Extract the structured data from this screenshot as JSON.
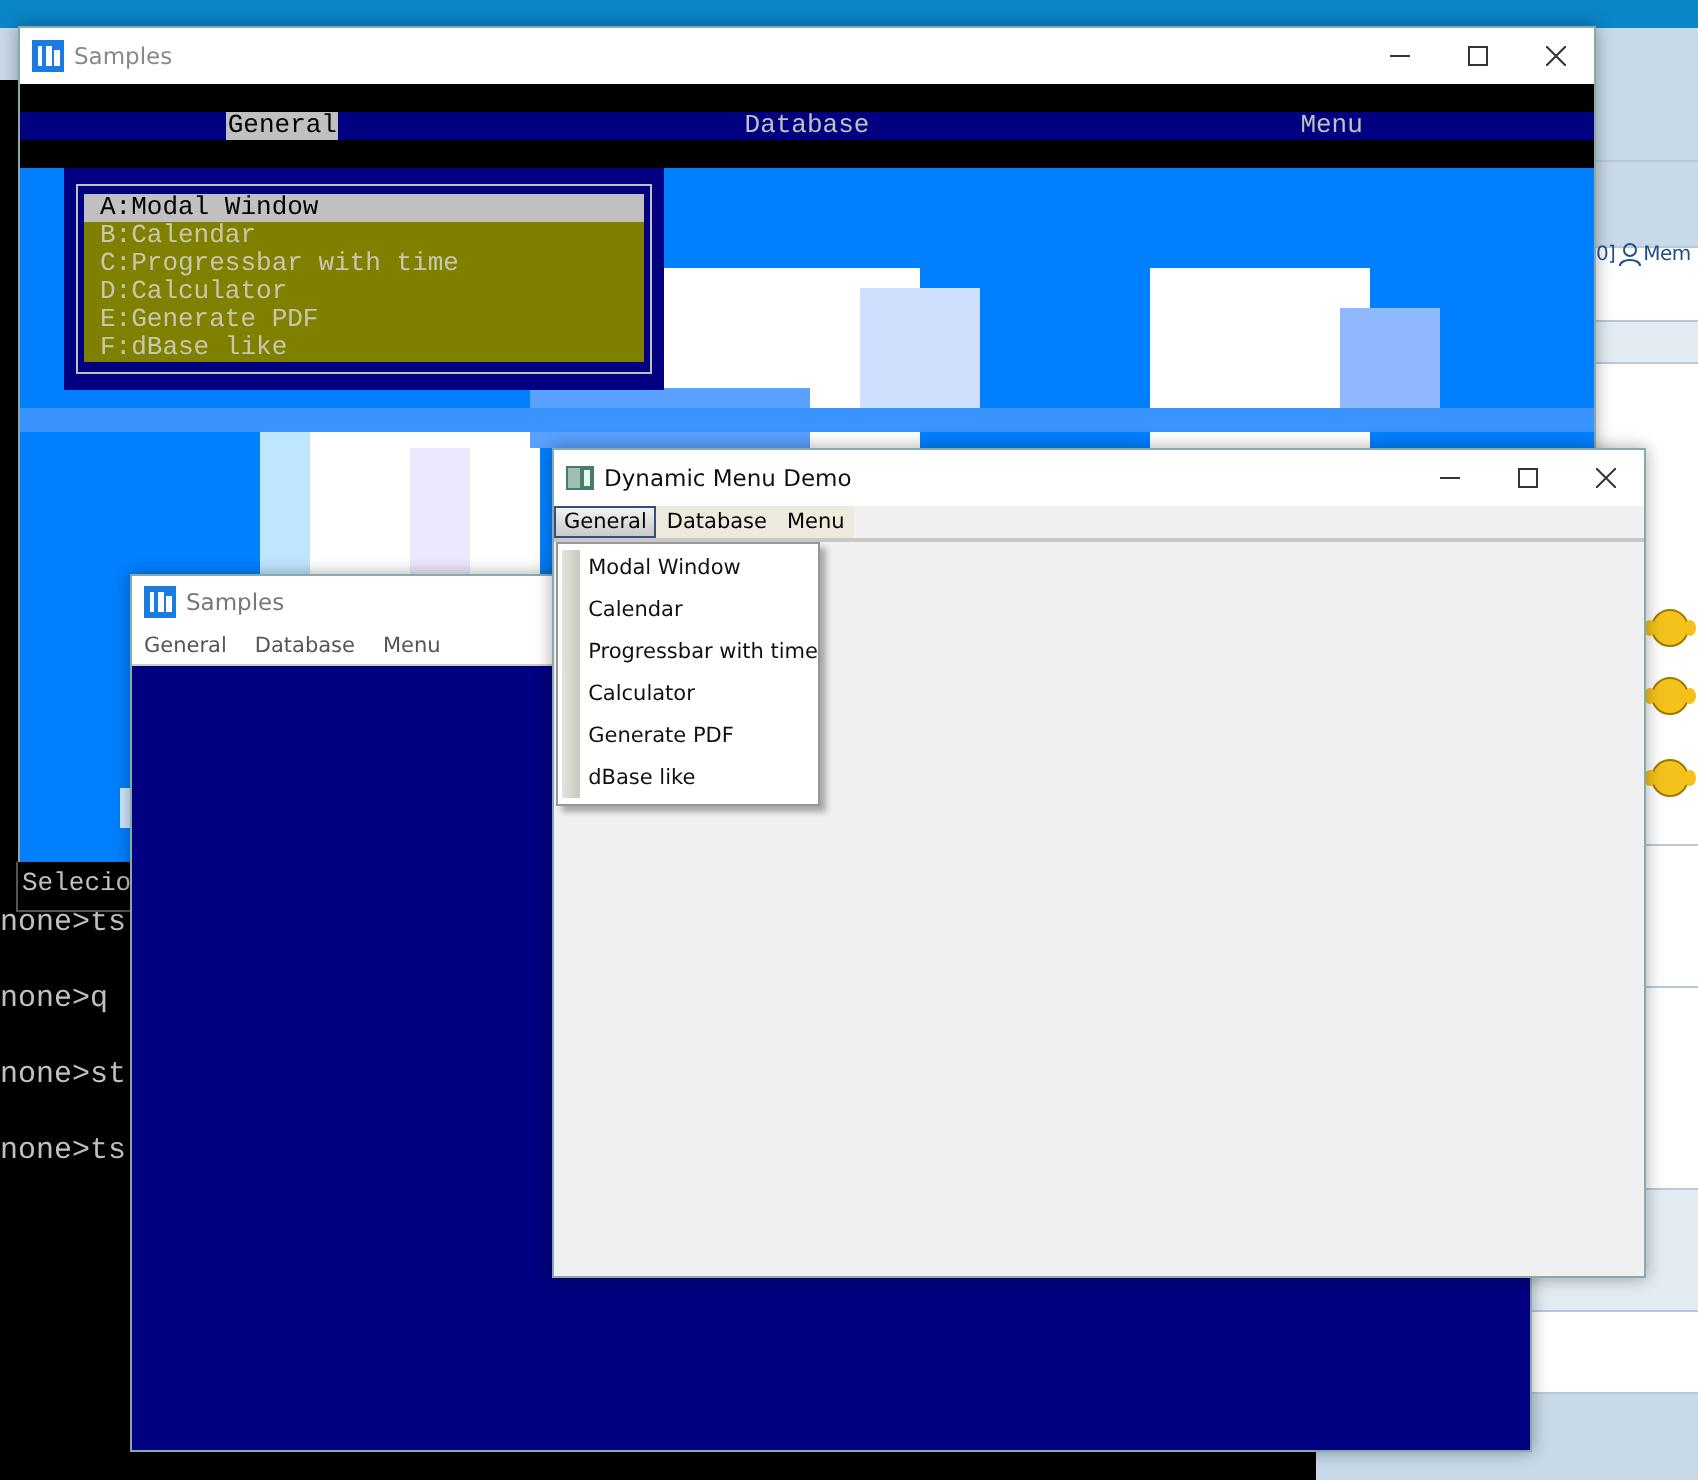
{
  "background_page": {
    "fragment": "0]",
    "link": "Mem"
  },
  "terminal": {
    "prompts": [
      "none>ts",
      "none>q",
      "none>st",
      "none>ts"
    ]
  },
  "samples_console": {
    "title": "Samples",
    "menu": [
      {
        "label": "General",
        "selected": true
      },
      {
        "label": "Database",
        "selected": false
      },
      {
        "label": "Menu",
        "selected": false
      }
    ],
    "dropdown": [
      {
        "label": "A:Modal Window",
        "selected": true
      },
      {
        "label": "B:Calendar",
        "selected": false
      },
      {
        "label": "C:Progressbar with time",
        "selected": false
      },
      {
        "label": "D:Calculator",
        "selected": false
      },
      {
        "label": "E:Generate PDF",
        "selected": false
      },
      {
        "label": "F:dBase like",
        "selected": false
      }
    ],
    "status": "Selecio"
  },
  "samples_gui": {
    "title": "Samples",
    "menu": [
      "General",
      "Database",
      "Menu"
    ]
  },
  "dynamic_menu_demo": {
    "title": "Dynamic Menu Demo",
    "menu": [
      {
        "label": "General",
        "selected": true
      },
      {
        "label": "Database",
        "selected": false
      },
      {
        "label": "Menu",
        "selected": false
      }
    ],
    "dropdown": [
      "Modal Window",
      "Calendar",
      "Progressbar with time",
      "Calculator",
      "Generate PDF",
      "dBase like"
    ]
  }
}
